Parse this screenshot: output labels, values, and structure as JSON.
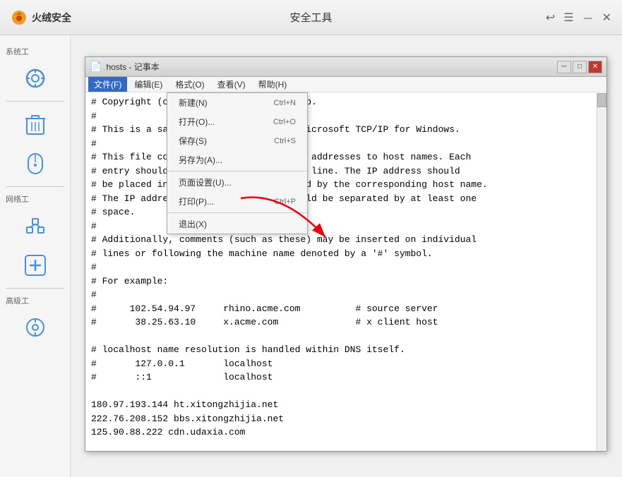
{
  "app": {
    "logo_text": "火绒安全",
    "title": "安全工具",
    "controls": {
      "back": "↩",
      "menu": "☰",
      "minimize": "－",
      "close": "✕"
    }
  },
  "sidebar": {
    "sections": [
      {
        "id": "system",
        "label": "系统工",
        "icon": "⟳"
      },
      {
        "id": "network",
        "label": "网络工",
        "icon": "🔌"
      },
      {
        "id": "advanced",
        "label": "高级工",
        "icon": "+"
      }
    ]
  },
  "notepad": {
    "title": "hosts - 记事本",
    "icon": "📄",
    "controls": {
      "minimize": "─",
      "maximize": "□",
      "close": "✕"
    },
    "menubar": {
      "file": "文件(F)",
      "edit": "编辑(E)",
      "format": "格式(O)",
      "view": "查看(V)",
      "help": "帮助(H)"
    },
    "file_menu": {
      "items": [
        {
          "label": "新建(N)",
          "shortcut": "Ctrl+N",
          "id": "new"
        },
        {
          "label": "打开(O)...",
          "shortcut": "Ctrl+O",
          "id": "open"
        },
        {
          "label": "保存(S)",
          "shortcut": "Ctrl+S",
          "id": "save"
        },
        {
          "label": "另存为(A)...",
          "shortcut": "",
          "id": "saveas"
        },
        {
          "separator": true
        },
        {
          "label": "页面设置(U)...",
          "shortcut": "",
          "id": "pagesetup"
        },
        {
          "label": "打印(P)...",
          "shortcut": "Ctrl+P",
          "id": "print"
        },
        {
          "separator": true
        },
        {
          "label": "退出(X)",
          "shortcut": "",
          "id": "exit"
        }
      ]
    },
    "content": "# Copyright (c) 1993-2009 Microsoft Corp.\n#\n# This is a sample HOSTS file used by Microsoft TCP/IP for Windows.\n#\n# This file contains the mappings of IP addresses to host names. Each\n# entry should be kept on an individual line. The IP address should\n# be placed in the first column followed by the corresponding host name.\n# The IP address and the host name should be separated by at least one\n# space.\n#\n# Additionally, comments (such as these) may be inserted on individual\n# lines or following the machine name denoted by a '#' symbol.\n#\n# For example:\n#\n#      102.54.94.97     rhino.acme.com          # source server\n#       38.25.63.10     x.acme.com              # x client host\n\n# localhost name resolution is handled within DNS itself.\n#\t127.0.0.1       localhost\n#\t::1             localhost\n\n180.97.193.144 ht.xitongzhijia.net\n222.76.208.152 bbs.xitongzhijia.net\n125.90.88.222 cdn.udaxia.com"
  }
}
